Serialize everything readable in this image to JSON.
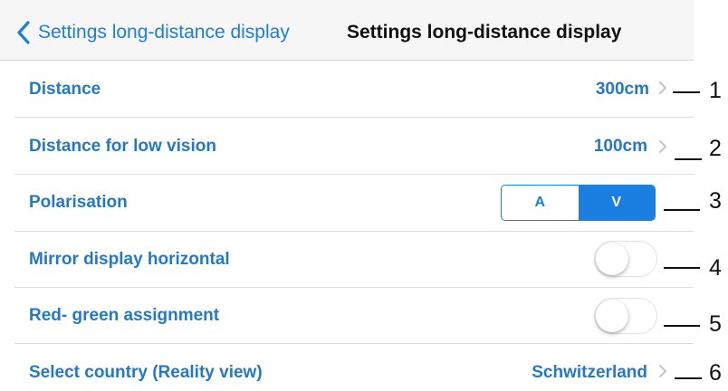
{
  "navbar": {
    "back_label": "Settings long-distance display",
    "title": "Settings long-distance display",
    "back_icon": "chevron-left-icon",
    "accent_color": "#1a7fe0"
  },
  "rows": [
    {
      "label": "Distance",
      "value": "300cm",
      "control": "disclosure",
      "callout": "1"
    },
    {
      "label": "Distance for low vision",
      "value": "100cm",
      "control": "disclosure",
      "callout": "2"
    },
    {
      "label": "Polarisation",
      "control": "segmented",
      "options": [
        "A",
        "V"
      ],
      "selected": "V",
      "callout": "3"
    },
    {
      "label": "Mirror display horizontal",
      "control": "toggle",
      "on": false,
      "callout": "4"
    },
    {
      "label": "Red- green assignment",
      "control": "toggle",
      "on": false,
      "callout": "5"
    },
    {
      "label": "Select country (Reality view)",
      "value": "Schwitzerland",
      "control": "disclosure",
      "callout": "6"
    }
  ],
  "colors": {
    "label": "#2379c7",
    "separator": "#dcdcdf",
    "navbar_bg": "#f6f6f7"
  }
}
